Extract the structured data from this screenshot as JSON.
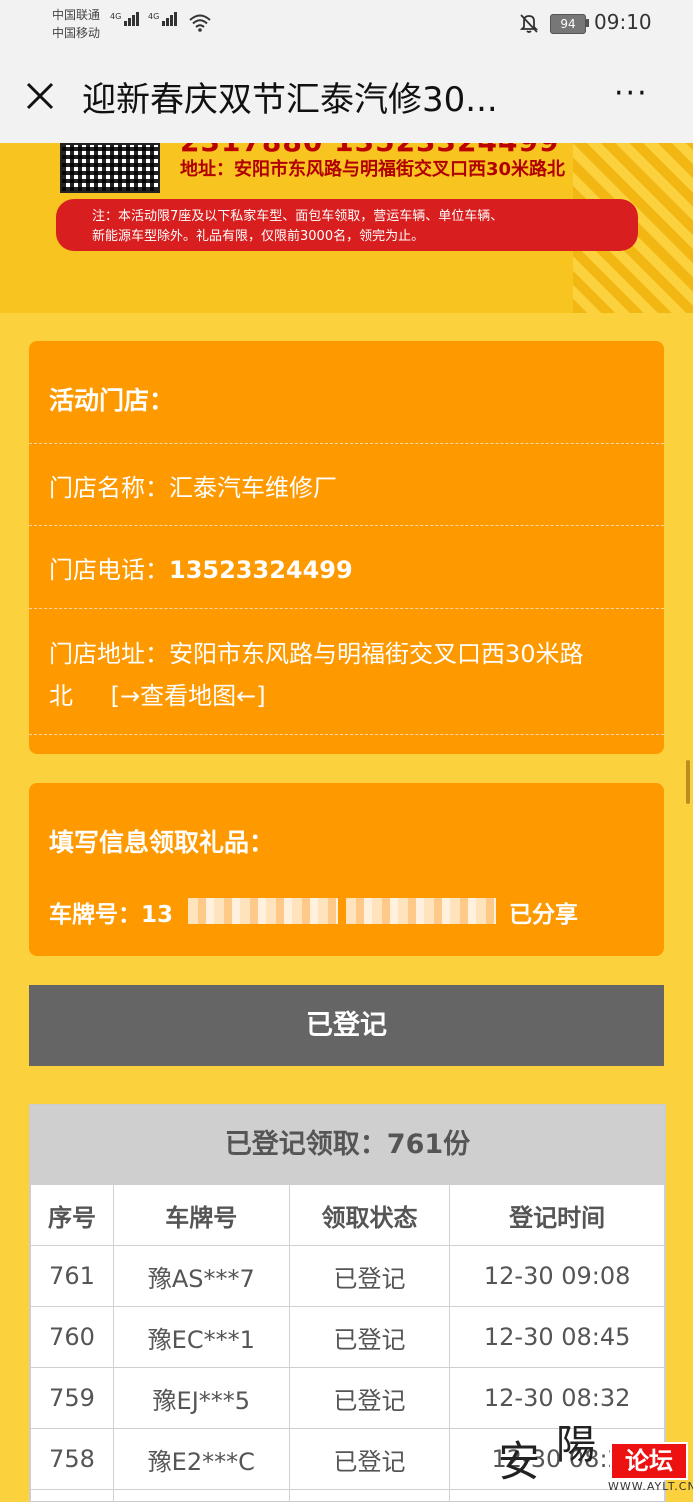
{
  "status_bar": {
    "carrier1": "中国联通",
    "carrier2": "中国移动",
    "net1": "4G",
    "net2": "4G",
    "battery": "94",
    "time": "09:10"
  },
  "nav": {
    "title": "迎新春庆双节汇泰汽修30...",
    "more": "···"
  },
  "banner": {
    "phone_partial": "2317880  13523324499",
    "address": "地址：安阳市东风路与明福街交叉口西30米路北",
    "note_line1": "注：本活动限7座及以下私家车型、面包车领取，营运车辆、单位车辆、",
    "note_line2": "新能源车型除外。礼品有限，仅限前3000名，领完为止。"
  },
  "store": {
    "heading": "活动门店：",
    "name_label": "门店名称：",
    "name_value": "汇泰汽车维修厂",
    "phone_label": "门店电话：",
    "phone_value": "13523324499",
    "address_label": "门店地址：",
    "address_value_line1": "安阳市东风路与明福街交叉口西30米路",
    "address_value_line2": "北",
    "map_link": "[→查看地图←]"
  },
  "form": {
    "heading": "填写信息领取礼品：",
    "plate_label": "车牌号：",
    "plate_value_partial": "13",
    "shared": "已分享"
  },
  "button": {
    "label": "已登记"
  },
  "registry": {
    "title": "已登记领取：761份",
    "headers": [
      "序号",
      "车牌号",
      "领取状态",
      "登记时间"
    ],
    "rows": [
      {
        "no": "761",
        "plate": "豫AS***7",
        "status": "已登记",
        "time": "12-30 09:08"
      },
      {
        "no": "760",
        "plate": "豫EC***1",
        "status": "已登记",
        "time": "12-30 08:45"
      },
      {
        "no": "759",
        "plate": "豫EJ***5",
        "status": "已登记",
        "time": "12-30 08:32"
      },
      {
        "no": "758",
        "plate": "豫E2***C",
        "status": "已登记",
        "time": "12-30 08:2"
      }
    ]
  },
  "watermark": {
    "char1": "安",
    "char2": "陽",
    "badge": "论坛",
    "url": "WWW.AYLT.CN"
  },
  "colors": {
    "page_bg": "#fbd13e",
    "card": "#ff9900",
    "button": "#656565",
    "note_red": "#d81e1e"
  }
}
